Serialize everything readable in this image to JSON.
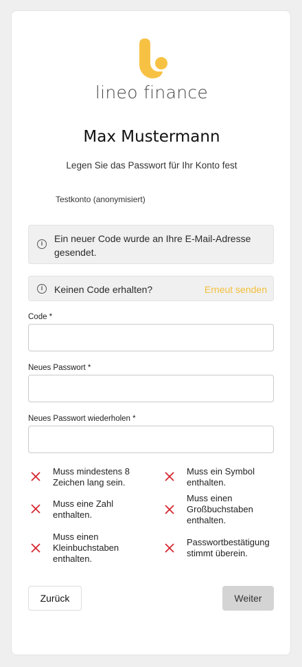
{
  "brand": {
    "name": "lineo finance",
    "logo_color": "#f7c244"
  },
  "heading": {
    "title": "Max Mustermann",
    "subtitle": "Legen Sie das Passwort für Ihr Konto fest",
    "account_label": "Testkonto (anonymisiert)"
  },
  "notices": {
    "code_sent": "Ein neuer Code wurde an Ihre E-Mail-Adresse gesendet.",
    "no_code": "Keinen Code erhalten?",
    "resend": "Erneut senden",
    "info_icon": "info-icon"
  },
  "form": {
    "code_label": "Code *",
    "code_value": "",
    "password_label": "Neues Passwort *",
    "password_value": "",
    "repeat_label": "Neues Passwort wiederholen *",
    "repeat_value": ""
  },
  "rules": [
    {
      "text": "Muss mindestens 8 Zeichen lang sein.",
      "met": false
    },
    {
      "text": "Muss ein Symbol enthalten.",
      "met": false
    },
    {
      "text": "Muss eine Zahl enthalten.",
      "met": false
    },
    {
      "text": "Muss einen Großbuchstaben enthalten.",
      "met": false
    },
    {
      "text": "Muss einen Kleinbuchstaben enthalten.",
      "met": false
    },
    {
      "text": "Passwortbestätigung stimmt überein.",
      "met": false
    }
  ],
  "actions": {
    "back": "Zurück",
    "next": "Weiter"
  },
  "colors": {
    "accent": "#f2bf3a",
    "error": "#d6262f",
    "disabled": "#d4d4d4"
  }
}
